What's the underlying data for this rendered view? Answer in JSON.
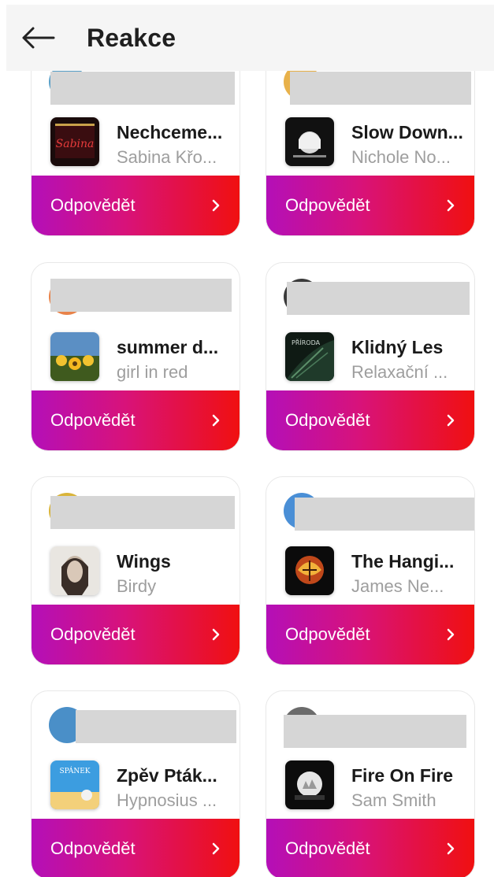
{
  "header": {
    "title": "Reakce",
    "back_icon": "arrow-left-icon"
  },
  "colors": {
    "reply_gradient_start": "#b40fb8",
    "reply_gradient_end": "#f01010",
    "title_text": "#1a1a1a",
    "artist_text": "#9e9e9e"
  },
  "cards": [
    {
      "title": "Nechceme...",
      "artist": "Sabina Křo...",
      "reply_label": "Odpovědět"
    },
    {
      "title": "Slow Down...",
      "artist": "Nichole No...",
      "reply_label": "Odpovědět"
    },
    {
      "title": "summer d...",
      "artist": "girl in red",
      "reply_label": "Odpovědět"
    },
    {
      "title": "Klidný Les",
      "artist": "Relaxační ...",
      "reply_label": "Odpovědět"
    },
    {
      "title": "Wings",
      "artist": "Birdy",
      "reply_label": "Odpovědět"
    },
    {
      "title": "The Hangi...",
      "artist": "James Ne...",
      "reply_label": "Odpovědět"
    },
    {
      "title": "Zpěv Pták...",
      "artist": "Hypnosius ...",
      "reply_label": "Odpovědět"
    },
    {
      "title": "Fire On Fire",
      "artist": "Sam Smith",
      "reply_label": "Odpovědět"
    }
  ]
}
